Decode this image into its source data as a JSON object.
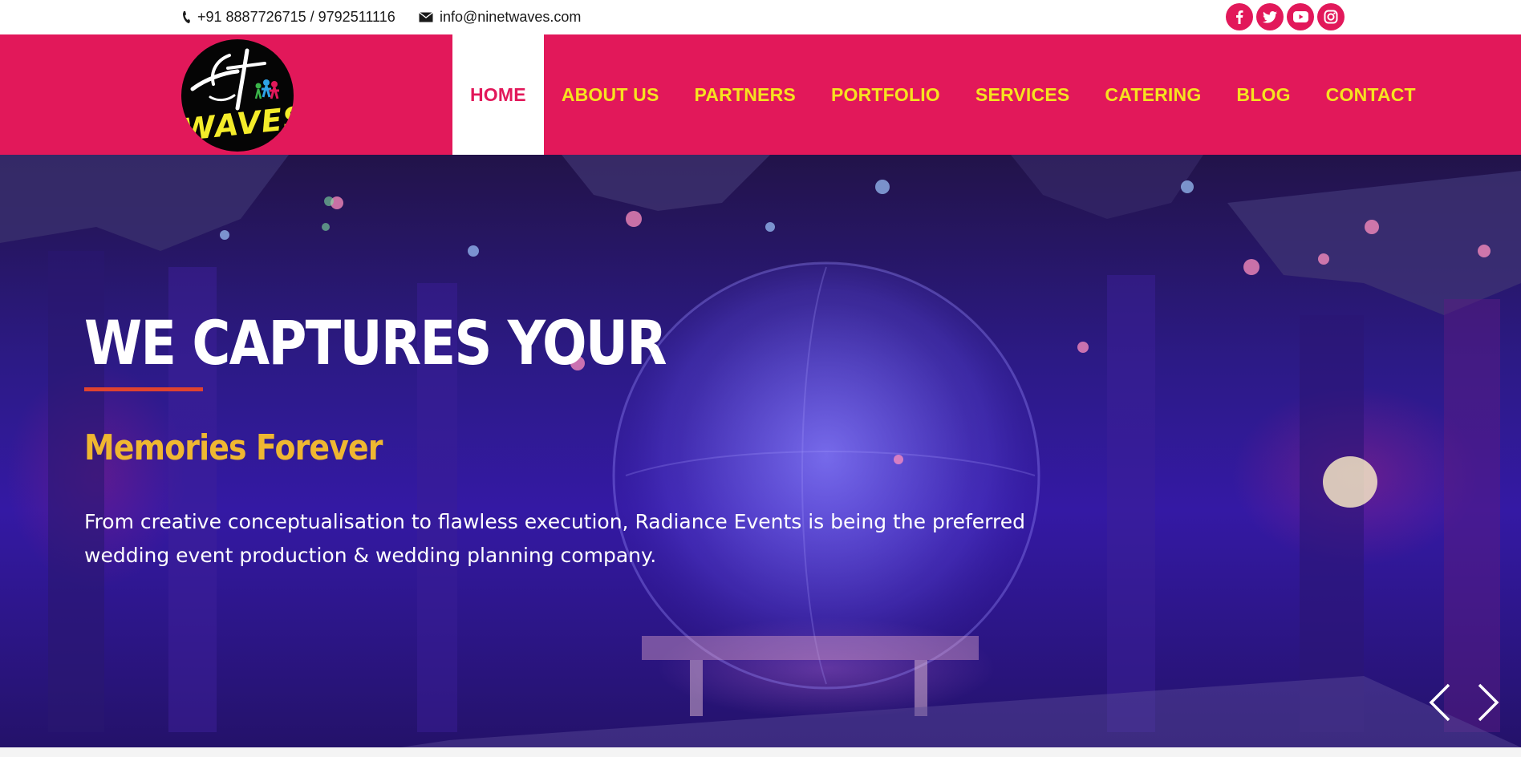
{
  "topbar": {
    "phone": "+91 8887726715 / 9792511116",
    "email": "info@ninetwaves.com",
    "phone_icon": "phone-icon",
    "email_icon": "envelope-icon",
    "socials": [
      "facebook-icon",
      "twitter-icon",
      "youtube-icon",
      "instagram-icon"
    ]
  },
  "header": {
    "logo_text": "WAVES",
    "nav": [
      "HOME",
      "ABOUT US",
      "PARTNERS",
      "PORTFOLIO",
      "SERVICES",
      "CATERING",
      "BLOG",
      "CONTACT"
    ],
    "active_nav": "HOME"
  },
  "hero": {
    "title": "WE CAPTURES YOUR",
    "subtitle": "Memories Forever",
    "description": "From creative conceptualisation to flawless execution, Radiance Events is being the preferred wedding event production & wedding planning company.",
    "prev_icon": "chevron-left-icon",
    "next_icon": "chevron-right-icon"
  },
  "colors": {
    "brand_pink": "#e2185a",
    "nav_yellow": "#f6e31f",
    "subtitle_gold": "#efb731",
    "underline_red": "#e0432f"
  }
}
